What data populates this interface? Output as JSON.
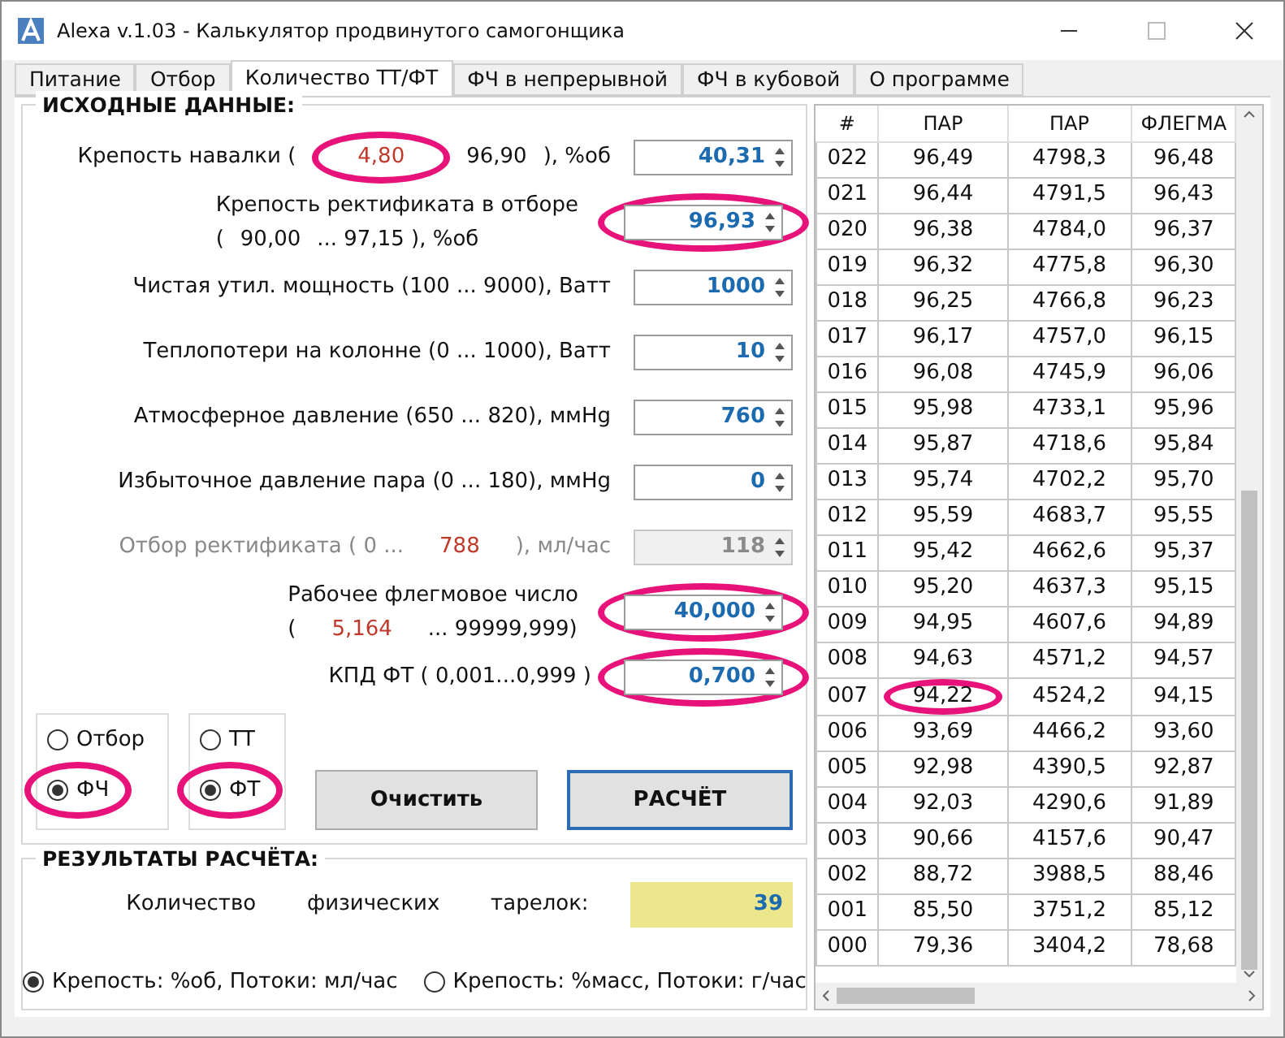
{
  "window": {
    "title": "Alexa  v.1.03 - Калькулятор продвинутого самогонщика"
  },
  "tabs": [
    {
      "label": "Питание",
      "selected": false
    },
    {
      "label": "Отбор",
      "selected": false
    },
    {
      "label": "Количество ТТ/ФТ",
      "selected": true
    },
    {
      "label": "ФЧ в непрерывной",
      "selected": false
    },
    {
      "label": "ФЧ в кубовой",
      "selected": false
    },
    {
      "label": "О программе",
      "selected": false
    }
  ],
  "inputs_title": "ИСХОДНЫЕ ДАННЫЕ:",
  "inputs": [
    {
      "kind": "inline",
      "parts": [
        {
          "text": "Крепость навалки (",
          "limit": false
        },
        {
          "text": "4,80",
          "limit": true,
          "circled": true
        },
        {
          "text": "96,90",
          "limit": false
        },
        {
          "text": "), %об",
          "limit": false
        }
      ],
      "value": "40,31",
      "disabled": false,
      "circled": false
    },
    {
      "kind": "two_line",
      "title": "Крепость ректификата в отборе",
      "parts": [
        {
          "text": "(",
          "limit": false
        },
        {
          "text": "90,00",
          "limit": false
        },
        {
          "text": "... 97,15 ), %об",
          "limit": false
        }
      ],
      "value": "96,93",
      "disabled": false,
      "circled": true
    },
    {
      "kind": "inline",
      "parts": [
        {
          "text": "Чистая утил. мощность (100 ... 9000), Ватт",
          "limit": false
        }
      ],
      "value": "1000",
      "disabled": false,
      "circled": false
    },
    {
      "kind": "inline",
      "parts": [
        {
          "text": "Теплопотери на колонне (0 ... 1000), Ватт",
          "limit": false
        }
      ],
      "value": "10",
      "disabled": false,
      "circled": false
    },
    {
      "kind": "inline",
      "parts": [
        {
          "text": "Атмосферное давление (650 ... 820), ммHg",
          "limit": false
        }
      ],
      "value": "760",
      "disabled": false,
      "circled": false
    },
    {
      "kind": "inline",
      "parts": [
        {
          "text": "Избыточное давление пара (0  ... 180), ммHg",
          "limit": false
        }
      ],
      "value": "0",
      "disabled": false,
      "circled": false
    },
    {
      "kind": "inline",
      "parts": [
        {
          "text": "Отбор ректификата ( 0  ...",
          "limit": false
        },
        {
          "text": "788",
          "limit": true
        },
        {
          "text": "), мл/час",
          "limit": false
        }
      ],
      "value": "118",
      "disabled": true,
      "circled": false
    },
    {
      "kind": "two_line",
      "title": "Рабочее флегмовое число",
      "parts": [
        {
          "text": "(",
          "limit": false
        },
        {
          "text": "5,164",
          "limit": true
        },
        {
          "text": "... 99999,999)",
          "limit": false
        }
      ],
      "value": "40,000",
      "disabled": false,
      "circled": true
    },
    {
      "kind": "inline",
      "parts": [
        {
          "text": "КПД ФТ ( 0,001...0,999 )",
          "limit": false
        }
      ],
      "value": "0,700",
      "disabled": false,
      "circled": true
    }
  ],
  "radio_groups": [
    [
      {
        "label": "Отбор",
        "selected": false,
        "circled": false
      },
      {
        "label": "ФЧ",
        "selected": true,
        "circled": true
      }
    ],
    [
      {
        "label": "ТТ",
        "selected": false,
        "circled": false
      },
      {
        "label": "ФТ",
        "selected": true,
        "circled": true
      }
    ]
  ],
  "buttons": [
    {
      "label": "Очистить",
      "default": false
    },
    {
      "label": "РАСЧЁТ",
      "default": true
    }
  ],
  "results": {
    "title": "РЕЗУЛЬТАТЫ РАСЧЁТА:",
    "label_parts": [
      "Количество",
      "физических",
      "тарелок:"
    ],
    "value": "39"
  },
  "units": [
    {
      "label": "Крепость: %об, Потоки: мл/час",
      "selected": true
    },
    {
      "label": "Крепость: %масс, Потоки: г/час",
      "selected": false
    }
  ],
  "table": {
    "columns": [
      "#",
      "ПАР",
      "ПАР",
      "ФЛЕГМА"
    ],
    "rows": [
      {
        "cells": [
          "022",
          "96,49",
          "4798,3",
          "96,48"
        ]
      },
      {
        "cells": [
          "021",
          "96,44",
          "4791,5",
          "96,43"
        ]
      },
      {
        "cells": [
          "020",
          "96,38",
          "4784,0",
          "96,37"
        ]
      },
      {
        "cells": [
          "019",
          "96,32",
          "4775,8",
          "96,30"
        ]
      },
      {
        "cells": [
          "018",
          "96,25",
          "4766,8",
          "96,23"
        ]
      },
      {
        "cells": [
          "017",
          "96,17",
          "4757,0",
          "96,15"
        ]
      },
      {
        "cells": [
          "016",
          "96,08",
          "4745,9",
          "96,06"
        ]
      },
      {
        "cells": [
          "015",
          "95,98",
          "4733,1",
          "95,96"
        ]
      },
      {
        "cells": [
          "014",
          "95,87",
          "4718,6",
          "95,84"
        ]
      },
      {
        "cells": [
          "013",
          "95,74",
          "4702,2",
          "95,70"
        ]
      },
      {
        "cells": [
          "012",
          "95,59",
          "4683,7",
          "95,55"
        ]
      },
      {
        "cells": [
          "011",
          "95,42",
          "4662,6",
          "95,37"
        ]
      },
      {
        "cells": [
          "010",
          "95,20",
          "4637,3",
          "95,15"
        ]
      },
      {
        "cells": [
          "009",
          "94,95",
          "4607,6",
          "94,89"
        ]
      },
      {
        "cells": [
          "008",
          "94,63",
          "4571,2",
          "94,57"
        ]
      },
      {
        "cells": [
          "007",
          "94,22",
          "4524,2",
          "94,15"
        ],
        "circled": [
          false,
          true,
          false,
          false
        ]
      },
      {
        "cells": [
          "006",
          "93,69",
          "4466,2",
          "93,60"
        ]
      },
      {
        "cells": [
          "005",
          "92,98",
          "4390,5",
          "92,87"
        ]
      },
      {
        "cells": [
          "004",
          "92,03",
          "4290,6",
          "91,89"
        ]
      },
      {
        "cells": [
          "003",
          "90,66",
          "4157,6",
          "90,47"
        ]
      },
      {
        "cells": [
          "002",
          "88,72",
          "3988,5",
          "88,46"
        ]
      },
      {
        "cells": [
          "001",
          "85,50",
          "3751,2",
          "85,12"
        ]
      },
      {
        "cells": [
          "000",
          "79,36",
          "3404,2",
          "78,68"
        ]
      }
    ]
  }
}
